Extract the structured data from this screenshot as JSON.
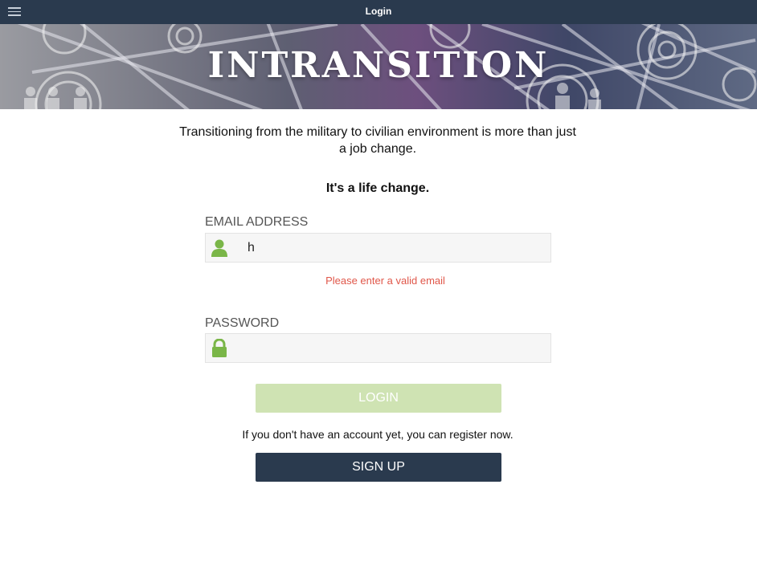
{
  "header": {
    "title": "Login",
    "menu_icon": "hamburger-menu-icon",
    "background": "#2a3a4e"
  },
  "banner": {
    "title": "INTRANSITION"
  },
  "intro": {
    "line": "Transitioning from the military to civilian environment is more than just a job change.",
    "tagline": "It's a life change."
  },
  "email": {
    "label": "EMAIL ADDRESS",
    "value": "h",
    "icon": "user-icon",
    "error": "Please enter a valid email"
  },
  "password": {
    "label": "PASSWORD",
    "value": "",
    "icon": "lock-icon"
  },
  "buttons": {
    "login": "LOGIN",
    "signup": "SIGN UP"
  },
  "register_text": "If you don't have an account yet, you can register now.",
  "colors": {
    "accent_green": "#7ab648",
    "error_red": "#e0574a",
    "disabled_green": "#cfe3b3",
    "navy": "#2a3a4e"
  }
}
